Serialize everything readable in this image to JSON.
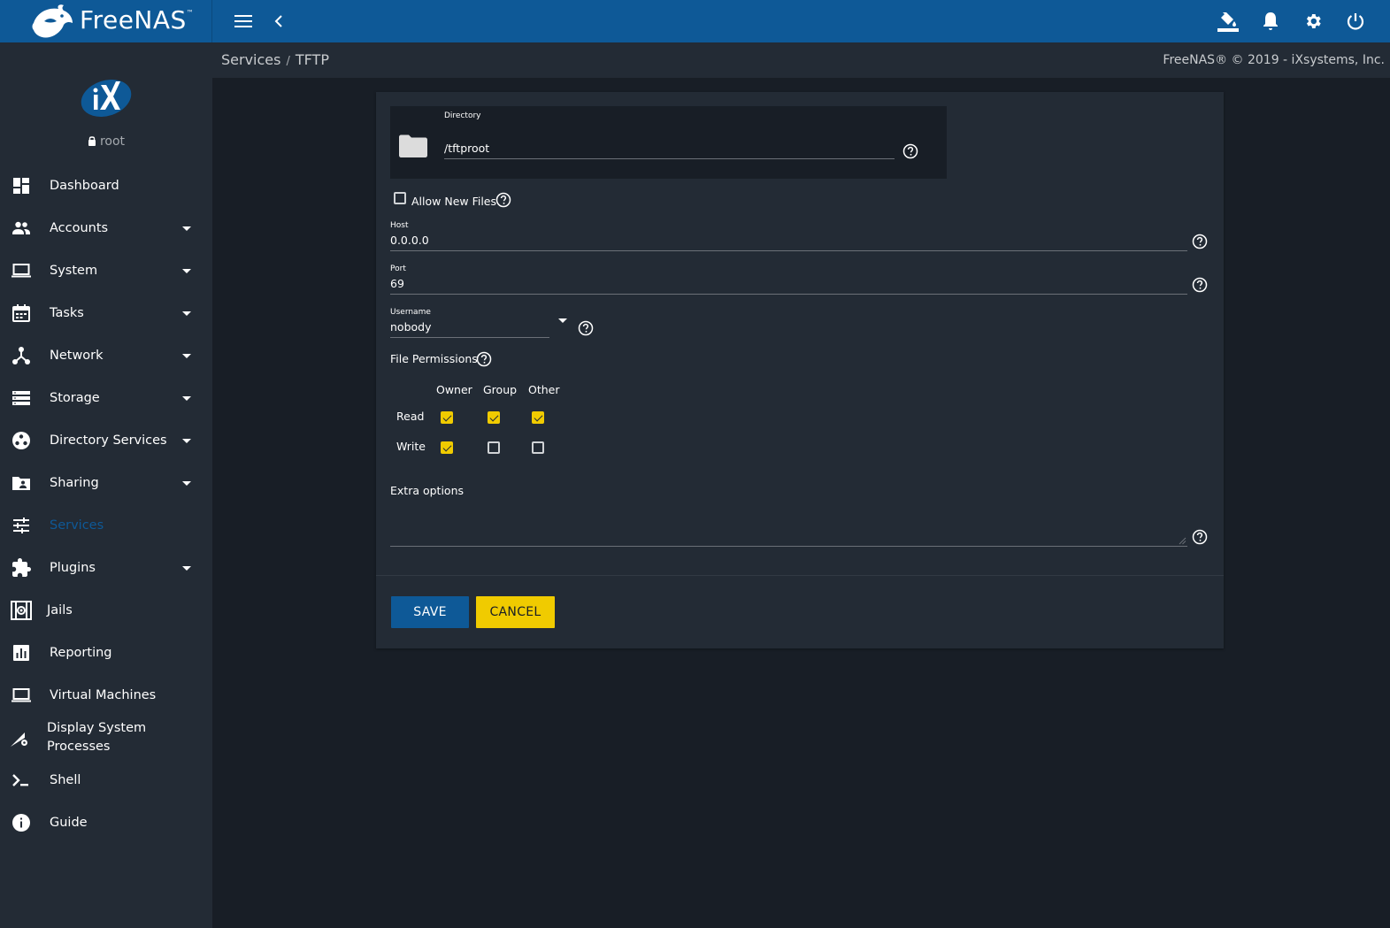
{
  "app": {
    "logo_text": "FreeNAS",
    "logo_mark": "™"
  },
  "topbar": {
    "icons": [
      "menu-icon",
      "back-chevron-icon",
      "theme-paint-icon",
      "notifications-bell-icon",
      "settings-gear-icon",
      "power-icon"
    ]
  },
  "user": {
    "lock_icon": "lock-icon",
    "name": "root"
  },
  "sidebar": {
    "items": [
      {
        "label": "Dashboard",
        "icon": "dashboard-icon",
        "caret": false
      },
      {
        "label": "Accounts",
        "icon": "accounts-icon",
        "caret": true
      },
      {
        "label": "System",
        "icon": "laptop-icon",
        "caret": true
      },
      {
        "label": "Tasks",
        "icon": "calendar-icon",
        "caret": true
      },
      {
        "label": "Network",
        "icon": "network-icon",
        "caret": true
      },
      {
        "label": "Storage",
        "icon": "storage-icon",
        "caret": true
      },
      {
        "label": "Directory Services",
        "icon": "directory-services-icon",
        "caret": true
      },
      {
        "label": "Sharing",
        "icon": "folder-shared-icon",
        "caret": true
      },
      {
        "label": "Services",
        "icon": "tune-icon",
        "caret": false,
        "active": true
      },
      {
        "label": "Plugins",
        "icon": "puzzle-icon",
        "caret": true
      },
      {
        "label": "Jails",
        "icon": "jail-icon",
        "caret": false
      },
      {
        "label": "Reporting",
        "icon": "chart-icon",
        "caret": false
      },
      {
        "label": "Virtual Machines",
        "icon": "laptop-icon",
        "caret": false
      },
      {
        "label_line1": "Display System",
        "label_line2": "Processes",
        "icon": "processes-icon",
        "caret": false
      },
      {
        "label": "Shell",
        "icon": "shell-prompt-icon",
        "caret": false
      },
      {
        "label": "Guide",
        "icon": "info-icon",
        "caret": false
      }
    ]
  },
  "breadcrumb": {
    "parent": "Services",
    "separator": "/",
    "current": "TFTP"
  },
  "copyright": "FreeNAS® © 2019 - iXsystems, Inc.",
  "form": {
    "directory": {
      "label": "Directory",
      "value": "/tftproot"
    },
    "allow_new_files": {
      "label": "Allow New Files",
      "checked": false
    },
    "host": {
      "label": "Host",
      "value": "0.0.0.0"
    },
    "port": {
      "label": "Port",
      "value": "69"
    },
    "username": {
      "label": "Username",
      "value": "nobody"
    },
    "file_permissions": {
      "label": "File Permissions",
      "columns": [
        "Owner",
        "Group",
        "Other"
      ],
      "rows": [
        {
          "label": "Read",
          "values": [
            true,
            true,
            true
          ]
        },
        {
          "label": "Write",
          "values": [
            true,
            false,
            false
          ]
        }
      ]
    },
    "extra_options": {
      "label": "Extra options",
      "value": ""
    }
  },
  "buttons": {
    "save": "SAVE",
    "cancel": "CANCEL"
  },
  "colors": {
    "topbar": "#0e5997",
    "sidebar": "#232b35",
    "background": "#181e26",
    "accent_yellow": "#f0cb00",
    "active_nav": "#0e5997"
  }
}
